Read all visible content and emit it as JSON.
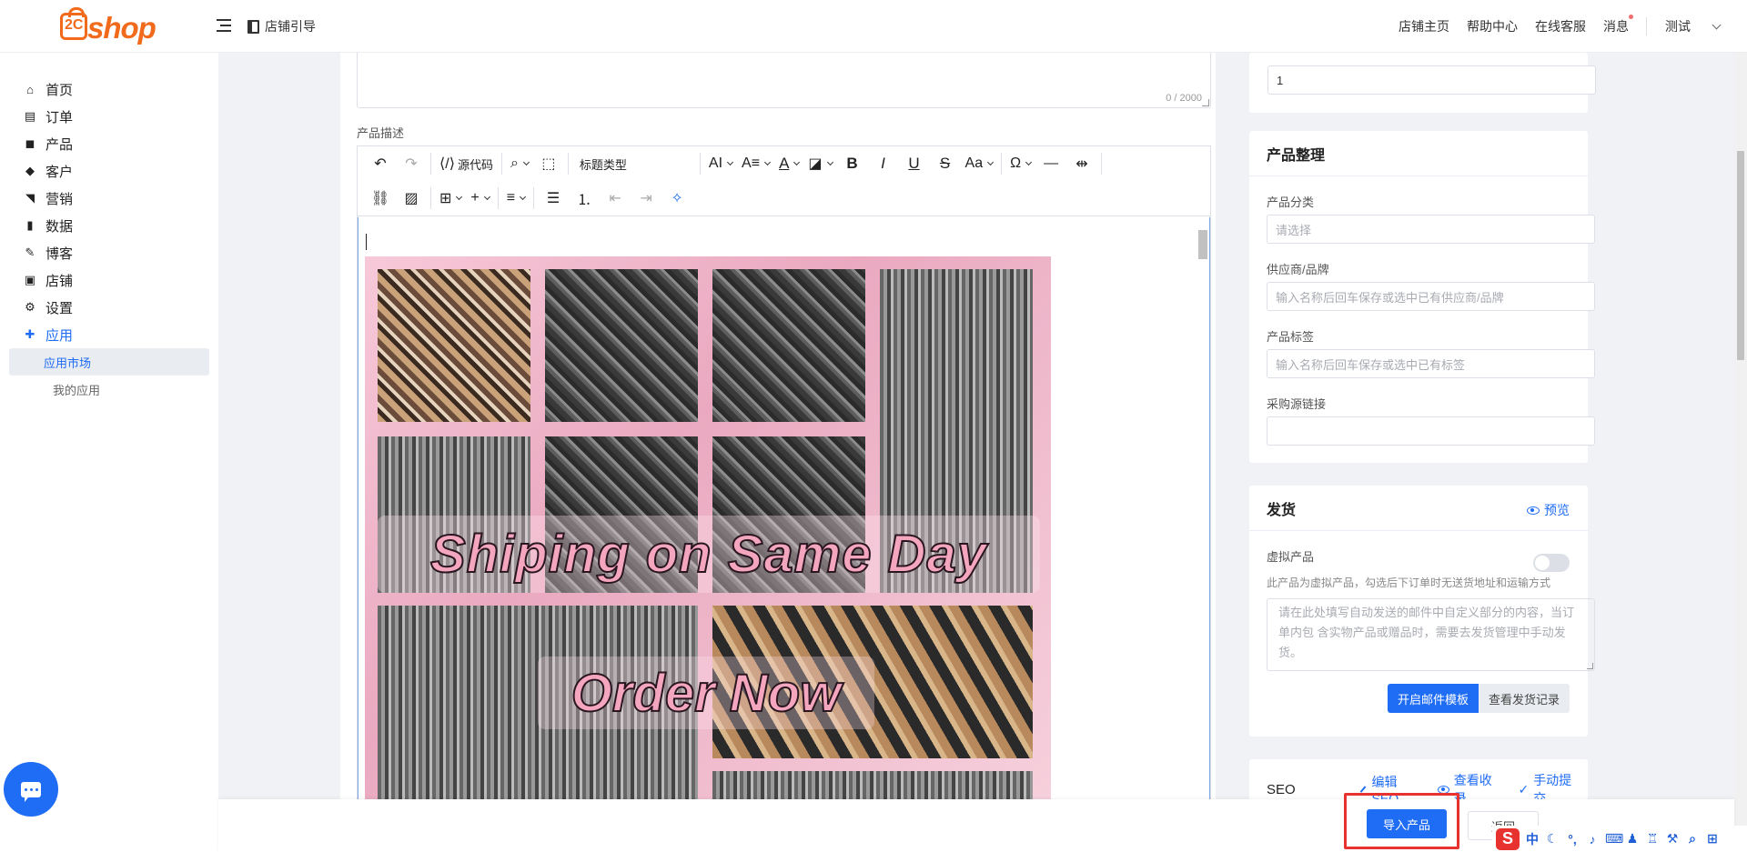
{
  "header": {
    "logo_text": "shop",
    "logo_mark": "2C",
    "guide_label": "店铺引导",
    "links": [
      "店铺主页",
      "帮助中心",
      "在线客服",
      "消息"
    ],
    "user_label": "测试"
  },
  "sidebar": {
    "items": [
      {
        "label": "首页",
        "icon": "home-icon",
        "glyph": "⌂"
      },
      {
        "label": "订单",
        "icon": "clipboard-icon",
        "glyph": "▤"
      },
      {
        "label": "产品",
        "icon": "bag-icon",
        "glyph": "◼"
      },
      {
        "label": "客户",
        "icon": "diamond-icon",
        "glyph": "◆"
      },
      {
        "label": "营销",
        "icon": "tag-icon",
        "glyph": "◥"
      },
      {
        "label": "数据",
        "icon": "bar-chart-icon",
        "glyph": "▮"
      },
      {
        "label": "博客",
        "icon": "edit-icon",
        "glyph": "✎"
      },
      {
        "label": "店铺",
        "icon": "store-icon",
        "glyph": "▣"
      },
      {
        "label": "设置",
        "icon": "gear-icon",
        "glyph": "⚙"
      },
      {
        "label": "应用",
        "icon": "puzzle-icon",
        "glyph": "✚"
      }
    ],
    "sub_items": [
      "应用市场",
      "我的应用"
    ]
  },
  "editor": {
    "counter": "0 / 2000",
    "desc_label": "产品描述",
    "source_label": "源代码",
    "heading_select": "标题类型",
    "image_banner_1": "Shiping on Same Day",
    "image_banner_2": "Order Now"
  },
  "top_card": {
    "qty_value": "1"
  },
  "organize": {
    "title": "产品整理",
    "category_label": "产品分类",
    "category_placeholder": "请选择",
    "supplier_label": "供应商/品牌",
    "supplier_placeholder": "输入名称后回车保存或选中已有供应商/品牌",
    "tag_label": "产品标签",
    "tag_placeholder": "输入名称后回车保存或选中已有标签",
    "source_label": "采购源链接",
    "source_value": ""
  },
  "shipping": {
    "title": "发货",
    "preview_label": "预览",
    "virtual_label": "虚拟产品",
    "virtual_hint": "此产品为虚拟产品，勾选后下订单时无送货地址和运输方式",
    "textarea_placeholder": "请在此处填写自动发送的邮件中自定义部分的内容，当订单内包 含实物产品或赠品时，需要去发货管理中手动发货。",
    "btn_template": "开启邮件模板",
    "btn_records": "查看发货记录"
  },
  "seo": {
    "title": "SEO",
    "edit_label": "编辑SEO",
    "index_label": "查看收录",
    "submit_label": "手动提交"
  },
  "actions": {
    "import_label": "导入产品",
    "back_label": "返回"
  },
  "ime": {
    "logo": "S",
    "lang": "中"
  },
  "colors": {
    "brand": "#f26a1b",
    "primary": "#1f6cf5",
    "highlight": "#e8322f"
  }
}
